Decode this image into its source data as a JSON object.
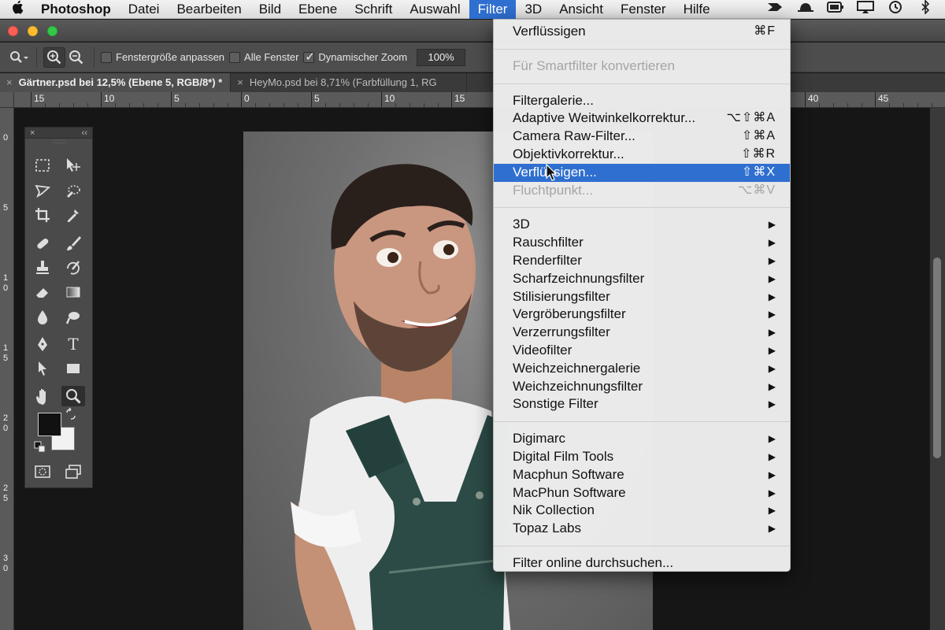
{
  "menubar": {
    "app_name": "Photoshop",
    "items": [
      "Datei",
      "Bearbeiten",
      "Bild",
      "Ebene",
      "Schrift",
      "Auswahl",
      "Filter",
      "3D",
      "Ansicht",
      "Fenster",
      "Hilfe"
    ],
    "active": "Filter",
    "apple_icon": "",
    "status_icons": [
      "wing-icon",
      "hat-icon",
      "battery-icon",
      "airplay-icon",
      "time-machine-icon",
      "bluetooth-icon"
    ]
  },
  "options_bar": {
    "checkbox_fit_window": "Fenstergröße anpassen",
    "checkbox_all_windows": "Alle Fenster",
    "checkbox_scrubby_zoom": "Dynamischer Zoom",
    "zoom_value": "100%"
  },
  "tabs": [
    {
      "label": "Gärtner.psd bei 12,5% (Ebene 5, RGB/8*) *",
      "close": "×"
    },
    {
      "label": "HeyMo.psd bei 8,71% (Farbfüllung 1, RG",
      "close": "×"
    }
  ],
  "ruler": {
    "h_labels": [
      "15",
      "10",
      "5",
      "0",
      "5",
      "10",
      "15",
      "40",
      "45"
    ],
    "v_labels": [
      "0",
      "5",
      "1 0",
      "1 5",
      "2 0",
      "2 5",
      "3 0"
    ]
  },
  "tools_panel": {
    "close": "×",
    "collapse": "‹‹",
    "tools": [
      "marquee-tool",
      "move-tool",
      "lasso-tool",
      "quick-selection-tool",
      "crop-tool",
      "eyedropper-tool",
      "healing-brush-tool",
      "brush-tool",
      "clone-stamp-tool",
      "history-brush-tool",
      "eraser-tool",
      "gradient-tool",
      "blur-tool",
      "dodge-tool",
      "pen-tool",
      "type-tool",
      "path-selection-tool",
      "rectangle-tool",
      "hand-tool",
      "zoom-tool",
      "quick-mask-tool",
      "screen-mode-tool"
    ],
    "type_glyph": "T",
    "foreground_color": "#111111",
    "background_color": "#f2f2f2"
  },
  "filter_menu": {
    "groups": [
      [
        {
          "label": "Verflüssigen",
          "shortcut": "⌘F",
          "disabled": false
        }
      ],
      [
        {
          "label": "Für Smartfilter konvertieren",
          "shortcut": "",
          "disabled": true
        }
      ],
      [
        {
          "label": "Filtergalerie...",
          "shortcut": "",
          "disabled": false
        },
        {
          "label": "Adaptive Weitwinkelkorrektur...",
          "shortcut": "⌥⇧⌘A",
          "disabled": false
        },
        {
          "label": "Camera Raw-Filter...",
          "shortcut": "⇧⌘A",
          "disabled": false
        },
        {
          "label": "Objektivkorrektur...",
          "shortcut": "⇧⌘R",
          "disabled": false
        },
        {
          "label": "Verflüssigen...",
          "shortcut": "⇧⌘X",
          "disabled": false,
          "highlighted": true
        },
        {
          "label": "Fluchtpunkt...",
          "shortcut": "⌥⌘V",
          "disabled": true
        }
      ],
      [
        {
          "label": "3D",
          "submenu": true
        },
        {
          "label": "Rauschfilter",
          "submenu": true
        },
        {
          "label": "Renderfilter",
          "submenu": true
        },
        {
          "label": "Scharfzeichnungsfilter",
          "submenu": true
        },
        {
          "label": "Stilisierungsfilter",
          "submenu": true
        },
        {
          "label": "Vergröberungsfilter",
          "submenu": true
        },
        {
          "label": "Verzerrungsfilter",
          "submenu": true
        },
        {
          "label": "Videofilter",
          "submenu": true
        },
        {
          "label": "Weichzeichnergalerie",
          "submenu": true
        },
        {
          "label": "Weichzeichnungsfilter",
          "submenu": true
        },
        {
          "label": "Sonstige Filter",
          "submenu": true
        }
      ],
      [
        {
          "label": "Digimarc",
          "submenu": true
        },
        {
          "label": "Digital Film Tools",
          "submenu": true
        },
        {
          "label": "Macphun Software",
          "submenu": true
        },
        {
          "label": "MacPhun Software",
          "submenu": true
        },
        {
          "label": "Nik Collection",
          "submenu": true
        },
        {
          "label": "Topaz Labs",
          "submenu": true
        }
      ],
      [
        {
          "label": "Filter online durchsuchen...",
          "shortcut": "",
          "disabled": false
        }
      ]
    ],
    "submenu_arrow": "▶",
    "highlight_color": "#2f6fd0"
  }
}
